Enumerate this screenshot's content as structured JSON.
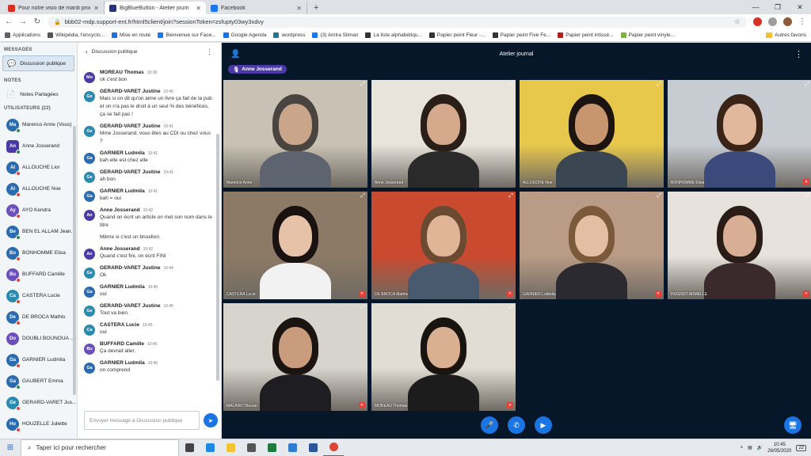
{
  "browser": {
    "tabs": [
      {
        "label": "Pour notre visio de mardi procha",
        "color": "#d93025"
      },
      {
        "label": "BigBlueButton - Atelier journ",
        "color": "#283274"
      },
      {
        "label": "Facebook",
        "color": "#1877f2"
      }
    ],
    "url": "bbb02-mdp.support-ent.fr/html5client/join?sessionToken=zsfupty03wy3xdvy",
    "bookmarks": [
      {
        "label": "Applications",
        "color": "#5f6368"
      },
      {
        "label": "Wikipédia, l'encyclo...",
        "color": "#555"
      },
      {
        "label": "Mise en route",
        "color": "#1a73e8"
      },
      {
        "label": "Bienvenue sur Face...",
        "color": "#1877f2"
      },
      {
        "label": "Google Agenda",
        "color": "#1a73e8"
      },
      {
        "label": "wordpress",
        "color": "#21759b"
      },
      {
        "label": "(3) Amira Sliman",
        "color": "#1877f2"
      },
      {
        "label": "La liste alphabétiqu...",
        "color": "#333"
      },
      {
        "label": "Papier peint Fleur -...",
        "color": "#333"
      },
      {
        "label": "Papier peint Five Fe...",
        "color": "#333"
      },
      {
        "label": "Papier peint intissé...",
        "color": "#b71c1c"
      },
      {
        "label": "Papier peint vinyle...",
        "color": "#7cb342"
      }
    ],
    "other_bookmarks": "Autres favoris"
  },
  "left_panel": {
    "messages_heading": "MESSAGES",
    "public_chat": "Discussion publique",
    "notes_heading": "NOTES",
    "shared_notes": "Notes Partagées",
    "users_heading": "UTILISATEURS (22)",
    "users": [
      {
        "initials": "Ma",
        "name": "Marenco Anne (Vous)",
        "color": "#2b6cb0",
        "shape": "circle",
        "status": "mic"
      },
      {
        "initials": "An",
        "name": "Anne Josserand",
        "color": "#4a3aa8",
        "shape": "square",
        "status": "mic"
      },
      {
        "initials": "Al",
        "name": "ALLOUCHE Lior",
        "color": "#2b6cb0",
        "shape": "circle",
        "status": "muted"
      },
      {
        "initials": "Al",
        "name": "ALLOUCHE Noe",
        "color": "#2b6cb0",
        "shape": "circle",
        "status": "muted"
      },
      {
        "initials": "Ay",
        "name": "AYO Kendra",
        "color": "#6b4fbb",
        "shape": "circle",
        "status": "muted"
      },
      {
        "initials": "Be",
        "name": "BEN EL ALLAM Jean...",
        "color": "#2b6cb0",
        "shape": "circle",
        "status": "mic"
      },
      {
        "initials": "Bo",
        "name": "BONHOMME Elisa",
        "color": "#2b6cb0",
        "shape": "circle",
        "status": "muted"
      },
      {
        "initials": "Bu",
        "name": "BUFFARD Camille",
        "color": "#6b4fbb",
        "shape": "circle",
        "status": "muted"
      },
      {
        "initials": "Ca",
        "name": "CASTERA Lucie",
        "color": "#2b8ab0",
        "shape": "circle",
        "status": "muted"
      },
      {
        "initials": "De",
        "name": "DE BROCA Mathis",
        "color": "#2b6cb0",
        "shape": "circle",
        "status": "muted"
      },
      {
        "initials": "Do",
        "name": "DOUBLI BOUNOUA ...",
        "color": "#6b4fbb",
        "shape": "circle",
        "status": "none"
      },
      {
        "initials": "Ga",
        "name": "GARNIER Ludmila",
        "color": "#2b6cb0",
        "shape": "circle",
        "status": "muted"
      },
      {
        "initials": "Ga",
        "name": "GAUBERT Emma",
        "color": "#2b6cb0",
        "shape": "circle",
        "status": "mic"
      },
      {
        "initials": "Ge",
        "name": "GERARD-VARET Jus...",
        "color": "#2b8ab0",
        "shape": "circle",
        "status": "muted"
      },
      {
        "initials": "Ho",
        "name": "HOUZELLE Juliette",
        "color": "#2b6cb0",
        "shape": "circle",
        "status": "muted"
      }
    ]
  },
  "chat": {
    "header": "Discussion publique",
    "input_placeholder": "Envoyer message à Discussion publique",
    "messages": [
      {
        "initials": "Mo",
        "color": "#4a3aa8",
        "name": "MOREAU Thomas",
        "time": "10:38",
        "lines": [
          "ok c'est bon"
        ]
      },
      {
        "initials": "Ge",
        "color": "#2b8ab0",
        "name": "GERARD-VARET Justine",
        "time": "10:40",
        "lines": [
          "Mais si on dit qu'on aime un livre ça fait de la pub et on n'a pas le droit à un seul % des bénéfices, ça se fait pas !"
        ]
      },
      {
        "initials": "Ge",
        "color": "#2b8ab0",
        "name": "GERARD-VARET Justine",
        "time": "10:41",
        "lines": [
          "Mme Josserand, vous êtes au CDI ou chez vous ?"
        ]
      },
      {
        "initials": "Ga",
        "color": "#2b6cb0",
        "name": "GARNIER Ludmila",
        "time": "10:41",
        "lines": [
          "bah elle est chez elle"
        ]
      },
      {
        "initials": "Ge",
        "color": "#2b8ab0",
        "name": "GERARD-VARET Justine",
        "time": "10:41",
        "lines": [
          "ah bon"
        ]
      },
      {
        "initials": "Ga",
        "color": "#2b6cb0",
        "name": "GARNIER Ludmila",
        "time": "10:41",
        "lines": [
          "bah = oui"
        ]
      },
      {
        "initials": "An",
        "color": "#4a3aa8",
        "name": "Anne Josserand",
        "time": "10:42",
        "lines": [
          "Quand on écrit un article on met son nom dans le titre",
          "Même si c'est un brouillon"
        ]
      },
      {
        "initials": "An",
        "color": "#4a3aa8",
        "name": "Anne Josserand",
        "time": "10:42",
        "lines": [
          "Quand c'est fini, on écrit FINI"
        ]
      },
      {
        "initials": "Ge",
        "color": "#2b8ab0",
        "name": "GERARD-VARET Justine",
        "time": "10:44",
        "lines": [
          "Ok"
        ]
      },
      {
        "initials": "Ga",
        "color": "#2b6cb0",
        "name": "GARNIER Ludmila",
        "time": "10:45",
        "lines": [
          "oui"
        ]
      },
      {
        "initials": "Ge",
        "color": "#2b8ab0",
        "name": "GERARD-VARET Justine",
        "time": "10:45",
        "lines": [
          "Tout va bien."
        ]
      },
      {
        "initials": "Ca",
        "color": "#2b8ab0",
        "name": "CASTERA Lucie",
        "time": "10:45",
        "lines": [
          "oui"
        ]
      },
      {
        "initials": "Bu",
        "color": "#6b4fbb",
        "name": "BUFFARD Camille",
        "time": "10:45",
        "lines": [
          "Ça devrait aller."
        ]
      },
      {
        "initials": "Ga",
        "color": "#2b6cb0",
        "name": "GARNIER Ludmila",
        "time": "10:45",
        "lines": [
          "on comprend"
        ]
      }
    ]
  },
  "main": {
    "title": "Atelier journal",
    "talking": "Anne Josserand",
    "videos": [
      {
        "label": "Marenco Anne",
        "bg": "#c9c2b4",
        "skin": "#c9a58a",
        "hair": "#4a4440",
        "shirt": "#5d6470",
        "muted": false
      },
      {
        "label": "Anne Josserand",
        "bg": "#e8e4dc",
        "skin": "#d4a98c",
        "hair": "#2a1e18",
        "shirt": "#2a2a2a",
        "muted": false
      },
      {
        "label": "ALLOUCHE Noe",
        "bg": "#e8c84a",
        "skin": "#c8966e",
        "hair": "#1c1410",
        "shirt": "#3a4652",
        "muted": false
      },
      {
        "label": "BONHOMME Elisa",
        "bg": "#c7ccd3",
        "skin": "#e2b89c",
        "hair": "#3a2418",
        "shirt": "#3b4a7a",
        "muted": true
      },
      {
        "label": "CASTERA Lucie",
        "bg": "#8d7a66",
        "skin": "#e6c2a8",
        "hair": "#1a1210",
        "shirt": "#f2f2f2",
        "muted": true
      },
      {
        "label": "DE BROCA Mathis",
        "bg": "#c94a2e",
        "skin": "#e0b496",
        "hair": "#6a4a30",
        "shirt": "#4a5a6e",
        "muted": true
      },
      {
        "label": "GARNIER Ludmila",
        "bg": "#b99b86",
        "skin": "#e4bea2",
        "hair": "#7a5a3a",
        "shirt": "#2a2a30",
        "muted": true
      },
      {
        "label": "HUGNOT ARMELLE",
        "bg": "#e7e3dc",
        "skin": "#d8ae94",
        "hair": "#2a1c16",
        "shirt": "#3a2a2e",
        "muted": true
      },
      {
        "label": "MALARD Titouan",
        "bg": "#d7d3cd",
        "skin": "#c99c7e",
        "hair": "#1c1410",
        "shirt": "#1e1e22",
        "muted": true
      },
      {
        "label": "MOREAU Thomas",
        "bg": "#e2ddd4",
        "skin": "#d9b092",
        "hair": "#1a1410",
        "shirt": "#1c1c1c",
        "muted": true
      }
    ]
  },
  "taskbar": {
    "search_placeholder": "Taper ici pour rechercher",
    "time": "10:45",
    "date": "26/05/2020",
    "notifications": "22",
    "apps": [
      {
        "name": "task-view",
        "color": "#444"
      },
      {
        "name": "edge",
        "color": "#1e88e5"
      },
      {
        "name": "explorer",
        "color": "#f4c430"
      },
      {
        "name": "store",
        "color": "#555"
      },
      {
        "name": "excel",
        "color": "#1e7a3e"
      },
      {
        "name": "photos",
        "color": "#2d7dd2"
      },
      {
        "name": "word",
        "color": "#2b579a"
      },
      {
        "name": "chrome",
        "color": "#db4437"
      }
    ]
  }
}
